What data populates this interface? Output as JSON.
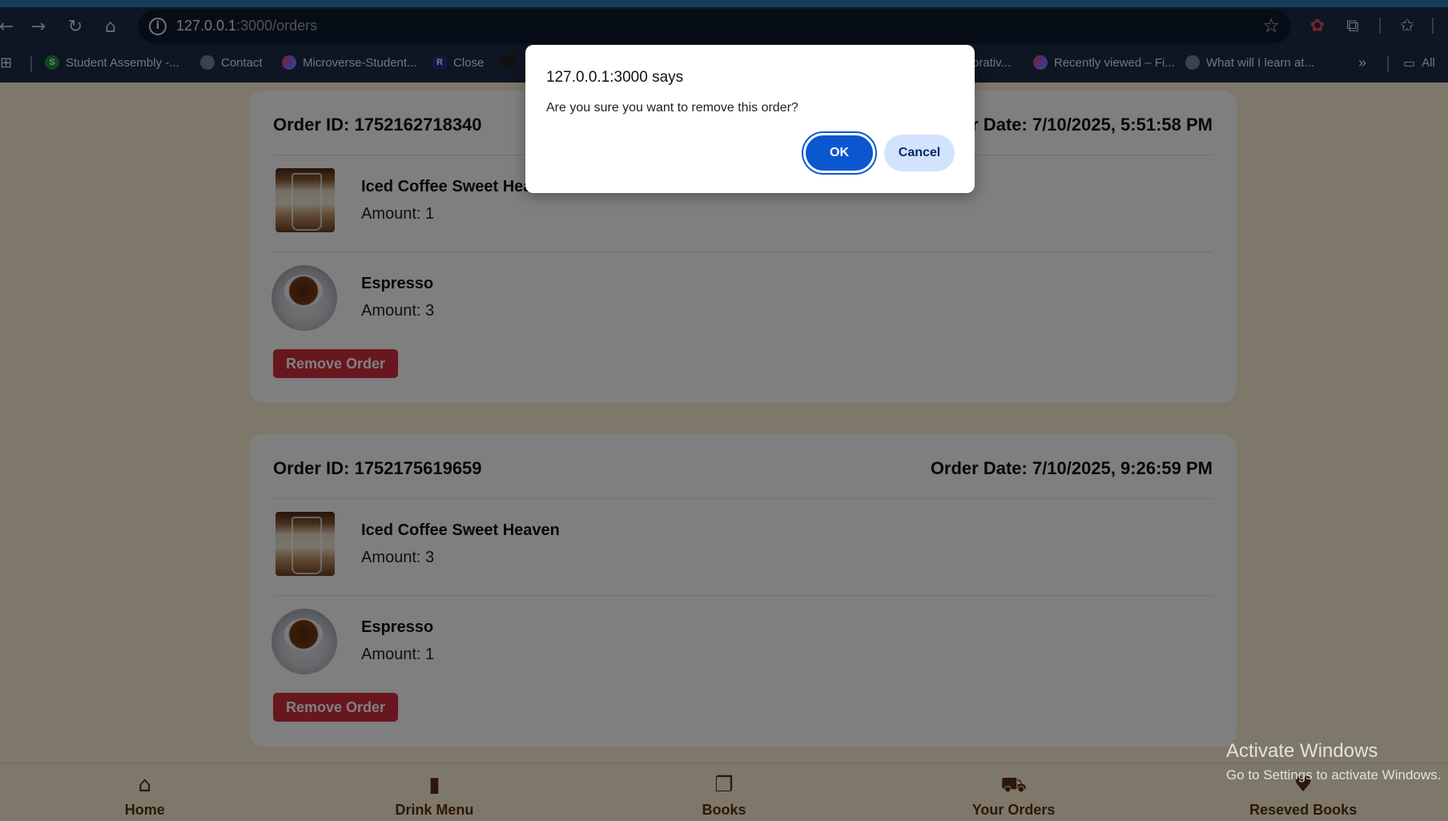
{
  "browser": {
    "url_host": "127.0.0.1",
    "url_rest": ":3000/orders",
    "bookmarks": [
      {
        "label": "Student Assembly -...",
        "icon": "S"
      },
      {
        "label": "Contact",
        "icon": ""
      },
      {
        "label": "Microverse-Student...",
        "icon": ""
      },
      {
        "label": "Close",
        "icon": "R"
      },
      {
        "label": "orativ...",
        "icon": ""
      },
      {
        "label": "Recently viewed – Fi...",
        "icon": ""
      },
      {
        "label": "What will I learn at...",
        "icon": ""
      },
      {
        "label": "All",
        "icon": ""
      }
    ],
    "more_label": "»"
  },
  "orders": [
    {
      "id_label": "Order ID: 1752162718340",
      "date_label": "Order Date: 7/10/2025, 5:51:58 PM",
      "items": [
        {
          "name": "Iced Coffee Sweet Heaven",
          "amount": "Amount: 1"
        },
        {
          "name": "Espresso",
          "amount": "Amount: 3"
        }
      ],
      "remove_label": "Remove Order"
    },
    {
      "id_label": "Order ID: 1752175619659",
      "date_label": "Order Date: 7/10/2025, 9:26:59 PM",
      "items": [
        {
          "name": "Iced Coffee Sweet Heaven",
          "amount": "Amount: 3"
        },
        {
          "name": "Espresso",
          "amount": "Amount: 1"
        }
      ],
      "remove_label": "Remove Order"
    }
  ],
  "bottom_nav": [
    {
      "label": "Home",
      "icon": "home-icon"
    },
    {
      "label": "Drink Menu",
      "icon": "drink-icon"
    },
    {
      "label": "Books",
      "icon": "books-icon"
    },
    {
      "label": "Your Orders",
      "icon": "cart-icon"
    },
    {
      "label": "Reseved Books",
      "icon": "heart-icon"
    }
  ],
  "dialog": {
    "title": "127.0.0.1:3000 says",
    "message": "Are you sure you want to remove this order?",
    "ok_label": "OK",
    "cancel_label": "Cancel"
  },
  "watermark": {
    "title": "Activate Windows",
    "subtitle": "Go to Settings to activate Windows."
  }
}
